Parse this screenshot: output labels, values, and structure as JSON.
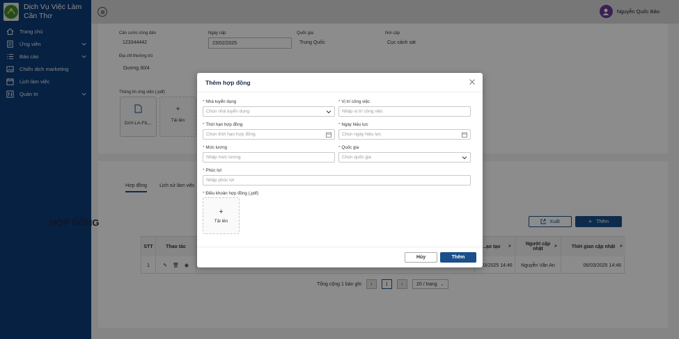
{
  "app": {
    "name": "Dịch Vụ Việc Làm Cần Thơ",
    "colors": {
      "sidebar": "#0b3d78",
      "primary": "#1a4f8b",
      "required": "#e0282e"
    }
  },
  "sidebar": {
    "items": [
      {
        "label": "Trang chủ",
        "icon": "home-icon",
        "has_children": false
      },
      {
        "label": "Ứng viên",
        "icon": "document-icon",
        "has_children": true
      },
      {
        "label": "Báo cáo",
        "icon": "list-icon",
        "has_children": true
      },
      {
        "label": "Chiến dịch marketing",
        "icon": "image-icon",
        "has_children": false
      },
      {
        "label": "Lịch làm việc",
        "icon": "calendar-icon",
        "has_children": false
      },
      {
        "label": "Quản trị",
        "icon": "admin-icon",
        "has_children": true
      }
    ]
  },
  "topbar": {
    "user_name": "Nguyễn Quốc Bảo"
  },
  "background_form": {
    "cccd_label": "Căn cước công dân",
    "cccd_value": "123344442",
    "ngay_cap_label": "Ngày cấp",
    "ngay_cap_value": "23/02/2025",
    "quoc_gia_label": "Quốc gia",
    "quoc_gia_value": "Trung Quốc",
    "noi_cap_label": "Nơi cấp",
    "noi_cap_value": "Cục cảnh sát",
    "dia_chi_label": "Địa chỉ thường trú",
    "dia_chi_value": "Dương 30/4",
    "files_label": "Thông tin ứng viên (.pdf)",
    "file_name": "DAY-LA-FIL...",
    "upload_label": "Tải lên"
  },
  "background_tabs": [
    "Hợp đồng",
    "Lịch sử làm việc"
  ],
  "contracts": {
    "title": "HỢP ĐỒNG",
    "export_label": "Xuất",
    "add_label": "Thêm",
    "columns": [
      "STT",
      "Thao tác",
      "...ạo tạo",
      "Người cập nhật",
      "Thời gian cập nhật"
    ],
    "rows": [
      {
        "stt": "1",
        "created": "...03/2025 14:46",
        "updater": "Nguyễn Văn An",
        "updated": "06/03/2025 14:46"
      }
    ],
    "pagination": {
      "total_text": "Tổng cộng 1 bản ghi",
      "current_page": "1",
      "page_size": "20 / trang"
    }
  },
  "modal": {
    "title": "Thêm hợp đồng",
    "fields": {
      "nha_tuyen_dung": {
        "label": "Nhà tuyển dụng",
        "placeholder": "Chọn nhà tuyển dụng"
      },
      "vi_tri": {
        "label": "Vị trí công việc",
        "placeholder": "Nhập vị trí công việc"
      },
      "thoi_han": {
        "label": "Thời hạn hợp đồng",
        "placeholder": "Chọn thời hạn hợp đồng"
      },
      "ngay_hieu_luc": {
        "label": "Ngày hiệu lực",
        "placeholder": "Chọn ngày hiệu lực"
      },
      "muc_luong": {
        "label": "Mức lương",
        "placeholder": "Nhập mức lương"
      },
      "quoc_gia": {
        "label": "Quốc gia",
        "placeholder": "Chọn quốc gia"
      },
      "phuc_loi": {
        "label": "Phúc lợi",
        "placeholder": "Nhập phúc lợi"
      },
      "dieu_khoan": {
        "label": "Điều khoản hợp đồng (.pdf)",
        "upload_label": "Tải lên"
      }
    },
    "cancel_label": "Hủy",
    "submit_label": "Thêm"
  }
}
